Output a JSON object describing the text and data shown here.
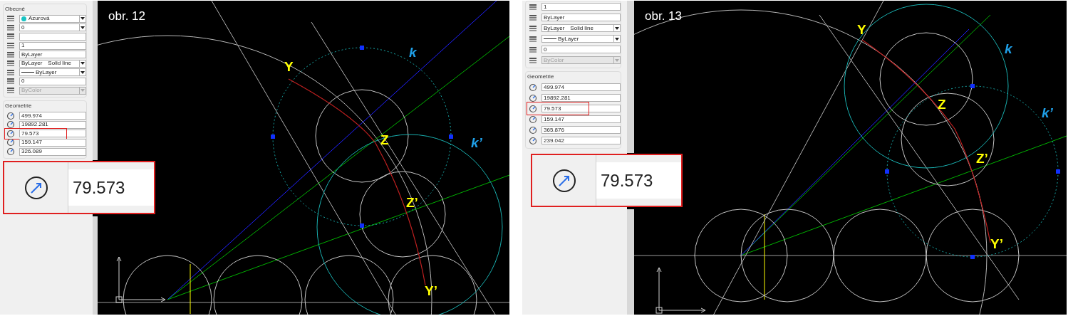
{
  "figures": [
    {
      "caption": "obr. 12",
      "sections": [
        {
          "title": "Obecné",
          "rows": [
            {
              "kind": "color",
              "value": "Azurová",
              "color": "#19c3c3"
            },
            {
              "kind": "dropdown",
              "value": "0"
            },
            {
              "kind": "field"
            },
            {
              "kind": "field",
              "value": "1"
            },
            {
              "kind": "field",
              "value": "ByLayer"
            },
            {
              "kind": "linetype",
              "value": "ByLayer",
              "value_2": "Solid line"
            },
            {
              "kind": "lineweight",
              "value": "ByLayer"
            },
            {
              "kind": "field",
              "value": "0"
            },
            {
              "kind": "disabled",
              "value": "ByColor"
            }
          ]
        },
        {
          "title": "Geometrie",
          "rows": [
            {
              "kind": "field",
              "value": "499.974",
              "highlighted": false
            },
            {
              "kind": "field",
              "value": "19892.281",
              "highlighted": false
            },
            {
              "kind": "field",
              "value": "79.573",
              "highlighted": true
            },
            {
              "kind": "field",
              "value": "159.147",
              "highlighted": false
            },
            {
              "kind": "field",
              "value": "326.089",
              "highlighted": false
            }
          ]
        }
      ],
      "callout": {
        "value": "79.573"
      },
      "labels": [
        {
          "text": "Y",
          "color": "#ffff00"
        },
        {
          "text": "Z",
          "color": "#ffff00"
        },
        {
          "text": "Z’",
          "color": "#ffff00"
        },
        {
          "text": "Y’",
          "color": "#ffff00"
        },
        {
          "text": "k",
          "color": "#1fa0e8"
        },
        {
          "text": "k’",
          "color": "#1fa0e8"
        }
      ]
    },
    {
      "caption": "obr. 13",
      "sections": [
        {
          "rows": [
            {
              "kind": "field",
              "value": "1"
            },
            {
              "kind": "field",
              "value": "ByLayer"
            },
            {
              "kind": "linetype",
              "value": "ByLayer",
              "value_2": "Solid line"
            },
            {
              "kind": "lineweight",
              "value": "ByLayer"
            },
            {
              "kind": "field",
              "value": "0"
            },
            {
              "kind": "disabled",
              "value": "ByColor"
            }
          ]
        },
        {
          "title": "Geometrie",
          "rows": [
            {
              "kind": "field",
              "value": "499.974",
              "highlighted": false
            },
            {
              "kind": "field",
              "value": "19892.281",
              "highlighted": false
            },
            {
              "kind": "field",
              "value": "79.573",
              "highlighted": true
            },
            {
              "kind": "field",
              "value": "159.147",
              "highlighted": false
            },
            {
              "kind": "field",
              "value": "365.876",
              "highlighted": false
            },
            {
              "kind": "field",
              "value": "239.042",
              "highlighted": false
            }
          ]
        }
      ],
      "callout": {
        "value": "79.573"
      },
      "labels": [
        {
          "text": "Y",
          "color": "#ffff00"
        },
        {
          "text": "Z",
          "color": "#ffff00"
        },
        {
          "text": "Z’",
          "color": "#ffff00"
        },
        {
          "text": "Y’",
          "color": "#ffff00"
        },
        {
          "text": "k",
          "color": "#1fa0e8"
        },
        {
          "text": "k’",
          "color": "#1fa0e8"
        }
      ]
    }
  ]
}
